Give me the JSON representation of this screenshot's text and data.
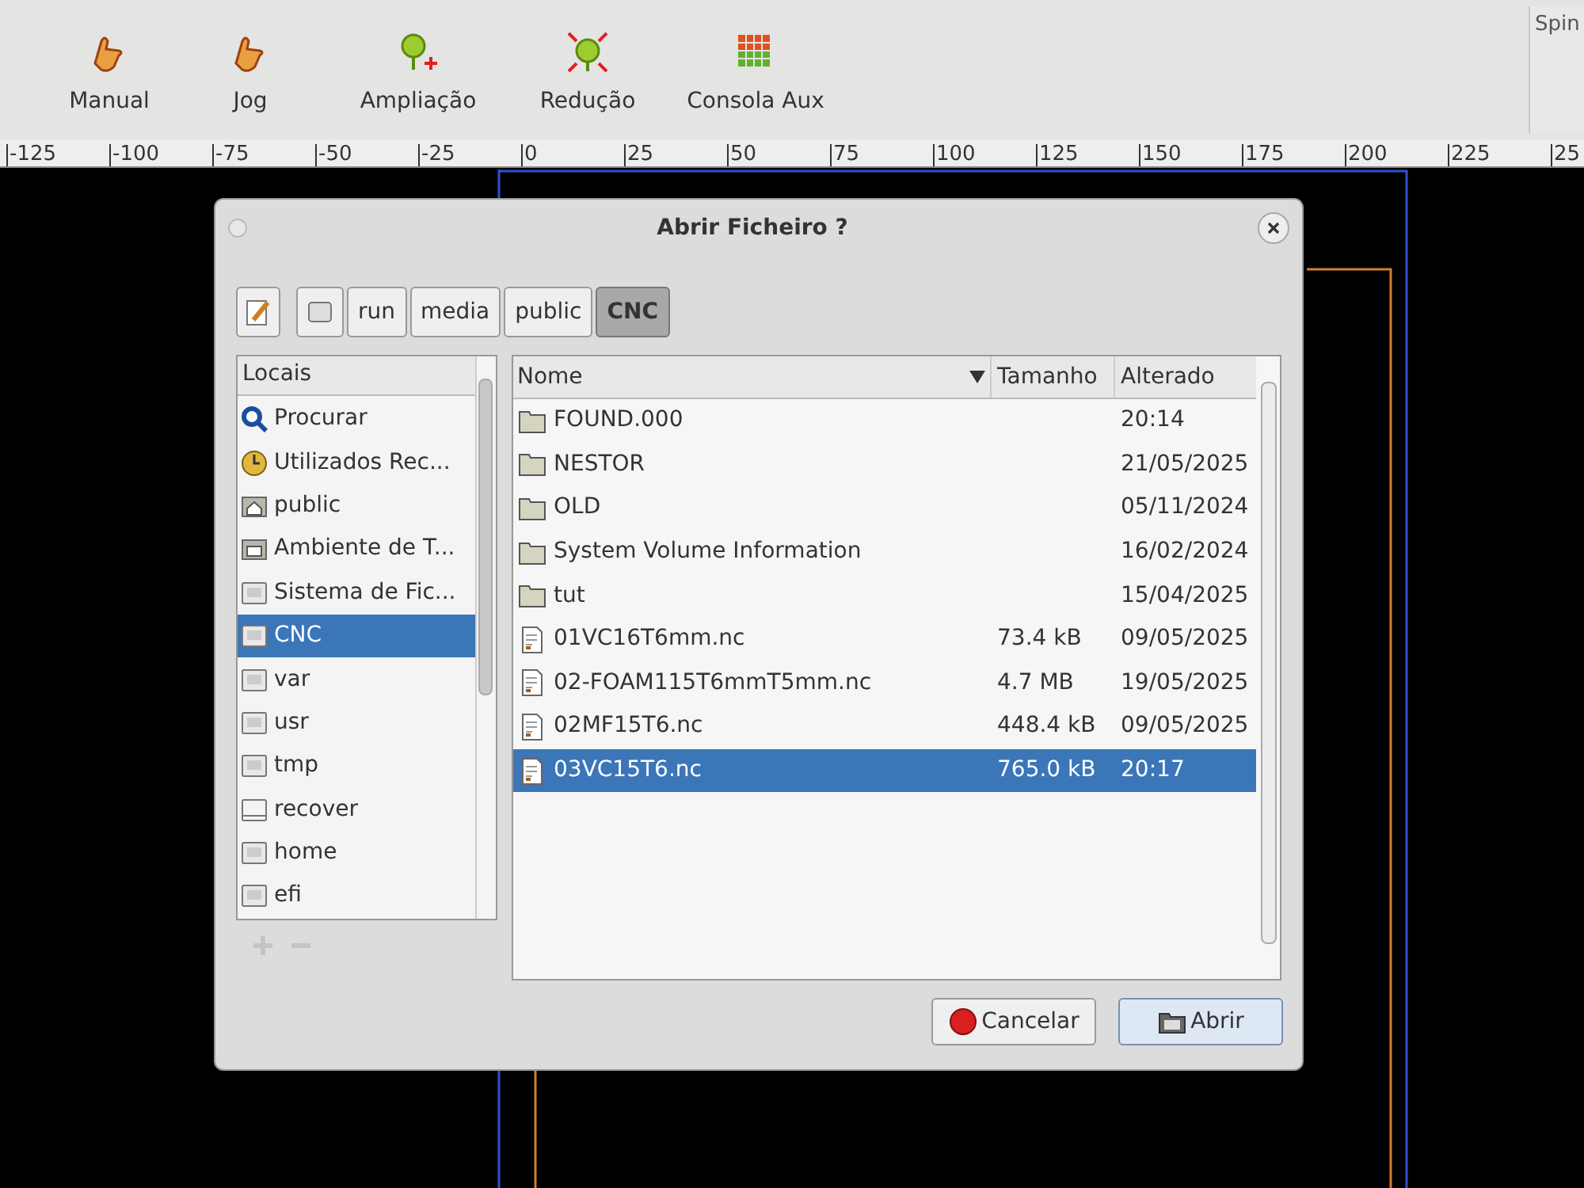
{
  "toolbar": {
    "buttons": [
      {
        "label": "Manual",
        "kind": "hand"
      },
      {
        "label": "Jog",
        "kind": "hand"
      },
      {
        "label": "Ampliação",
        "kind": "zoomin"
      },
      {
        "label": "Redução",
        "kind": "zoomout"
      },
      {
        "label": "Consola Aux",
        "kind": "grid"
      }
    ],
    "side_label": "Spin"
  },
  "ruler": {
    "labels": [
      "-125",
      "-100",
      "-75",
      "-50",
      "-25",
      "0",
      "25",
      "50",
      "75",
      "100",
      "125",
      "150",
      "175",
      "200",
      "225",
      "25"
    ]
  },
  "dialog": {
    "title": "Abrir Ficheiro ?",
    "path": [
      {
        "kind": "disk",
        "selected": false
      },
      {
        "label": "run",
        "kind": "text",
        "selected": false
      },
      {
        "label": "media",
        "kind": "text",
        "selected": false
      },
      {
        "label": "public",
        "kind": "text",
        "selected": false
      },
      {
        "label": "CNC",
        "kind": "text",
        "selected": true
      }
    ],
    "places_header": "Locais",
    "places": [
      {
        "label": "Procurar",
        "kind": "search",
        "selected": false
      },
      {
        "label": "Utilizados Rec...",
        "kind": "recent",
        "selected": false
      },
      {
        "label": "public",
        "kind": "home",
        "selected": false
      },
      {
        "label": "Ambiente de T...",
        "kind": "desktop",
        "selected": false
      },
      {
        "label": "Sistema de Fic...",
        "kind": "drive",
        "selected": false
      },
      {
        "label": "CNC",
        "kind": "drive",
        "selected": true
      },
      {
        "label": "var",
        "kind": "drive",
        "selected": false
      },
      {
        "label": "usr",
        "kind": "drive",
        "selected": false
      },
      {
        "label": "tmp",
        "kind": "drive",
        "selected": false
      },
      {
        "label": "recover",
        "kind": "blank",
        "selected": false
      },
      {
        "label": "home",
        "kind": "drive",
        "selected": false
      },
      {
        "label": "efi",
        "kind": "drive",
        "selected": false
      }
    ],
    "columns": [
      "Nome",
      "Tamanho",
      "Alterado"
    ],
    "files": [
      {
        "name": "FOUND.000",
        "modified": "20:14",
        "kind": "folder",
        "selected": false
      },
      {
        "name": "NESTOR",
        "modified": "21/05/2025",
        "kind": "folder",
        "selected": false
      },
      {
        "name": "OLD",
        "modified": "05/11/2024",
        "kind": "folder",
        "selected": false
      },
      {
        "name": "System Volume Information",
        "modified": "16/02/2024",
        "kind": "folder",
        "selected": false
      },
      {
        "name": "tut",
        "modified": "15/04/2025",
        "kind": "folder",
        "selected": false
      },
      {
        "name": "01VC16T6mm.nc",
        "size": "73.4 kB",
        "modified": "09/05/2025",
        "kind": "file",
        "selected": false
      },
      {
        "name": "02-FOAM115T6mmT5mm.nc",
        "size": "4.7 MB",
        "modified": "19/05/2025",
        "kind": "file",
        "selected": false
      },
      {
        "name": "02MF15T6.nc",
        "size": "448.4 kB",
        "modified": "09/05/2025",
        "kind": "file",
        "selected": false
      },
      {
        "name": "03VC15T6.nc",
        "size": "765.0 kB",
        "modified": "20:17",
        "kind": "file",
        "selected": true
      }
    ],
    "buttons": [
      {
        "label": "Cancelar",
        "kind": "cancel"
      },
      {
        "label": "Abrir",
        "kind": "open"
      }
    ]
  }
}
